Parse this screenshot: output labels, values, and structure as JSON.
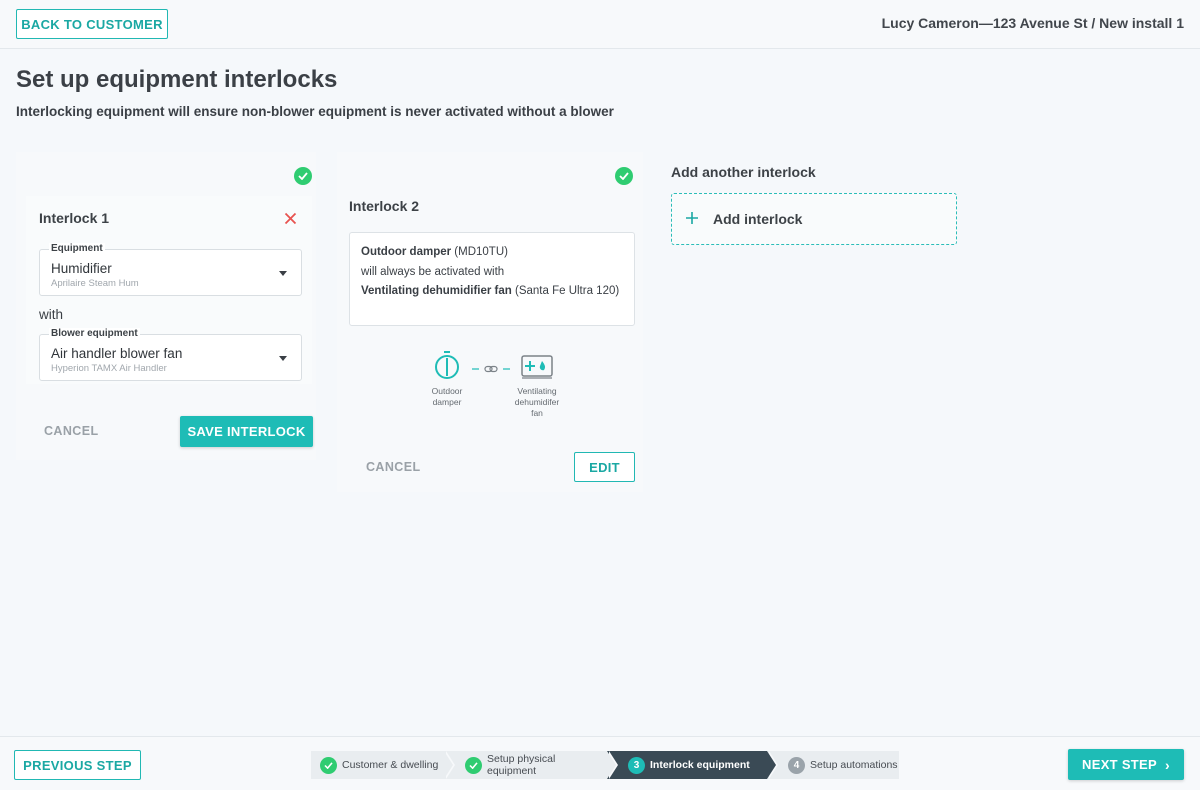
{
  "header": {
    "back_label": "BACK TO CUSTOMER",
    "breadcrumb": "Lucy Cameron—123 Avenue St / New install 1"
  },
  "page": {
    "title": "Set up equipment interlocks",
    "subtitle": "Interlocking equipment will ensure non-blower equipment is never activated without a blower"
  },
  "interlock1": {
    "title": "Interlock 1",
    "equipment_label": "Equipment",
    "equipment_value": "Humidifier",
    "equipment_hint": "Aprilaire Steam Hum",
    "with_label": "with",
    "blower_label": "Blower equipment",
    "blower_value": "Air handler blower fan",
    "blower_hint": "Hyperion TAMX Air Handler",
    "cancel_label": "CANCEL",
    "save_label": "SAVE INTERLOCK"
  },
  "interlock2": {
    "title": "Interlock 2",
    "desc_eq1_name": "Outdoor damper",
    "desc_eq1_model": "(MD10TU)",
    "desc_middle": "will always be activated with",
    "desc_eq2_name": "Ventilating dehumidifier fan",
    "desc_eq2_model": "(Santa Fe Ultra 120)",
    "eq1_caption_line1": "Outdoor",
    "eq1_caption_line2": "damper",
    "eq2_caption_line1": "Ventilating",
    "eq2_caption_line2": "dehumidifer",
    "eq2_caption_line3": "fan",
    "cancel_label": "CANCEL",
    "edit_label": "EDIT"
  },
  "add": {
    "title": "Add another interlock",
    "button_label": "Add interlock"
  },
  "footer": {
    "prev_label": "PREVIOUS STEP",
    "next_label": "NEXT STEP",
    "next_chevron": "›",
    "steps": [
      {
        "num": "",
        "label": "Customer & dwelling"
      },
      {
        "num": "",
        "label": "Setup physical equipment"
      },
      {
        "num": "3",
        "label": "Interlock equipment"
      },
      {
        "num": "4",
        "label": "Setup automations"
      }
    ]
  },
  "colors": {
    "accent": "#1ebcb6",
    "success": "#2fcc71",
    "danger": "#e8524f",
    "active_step": "#3a4a55"
  }
}
